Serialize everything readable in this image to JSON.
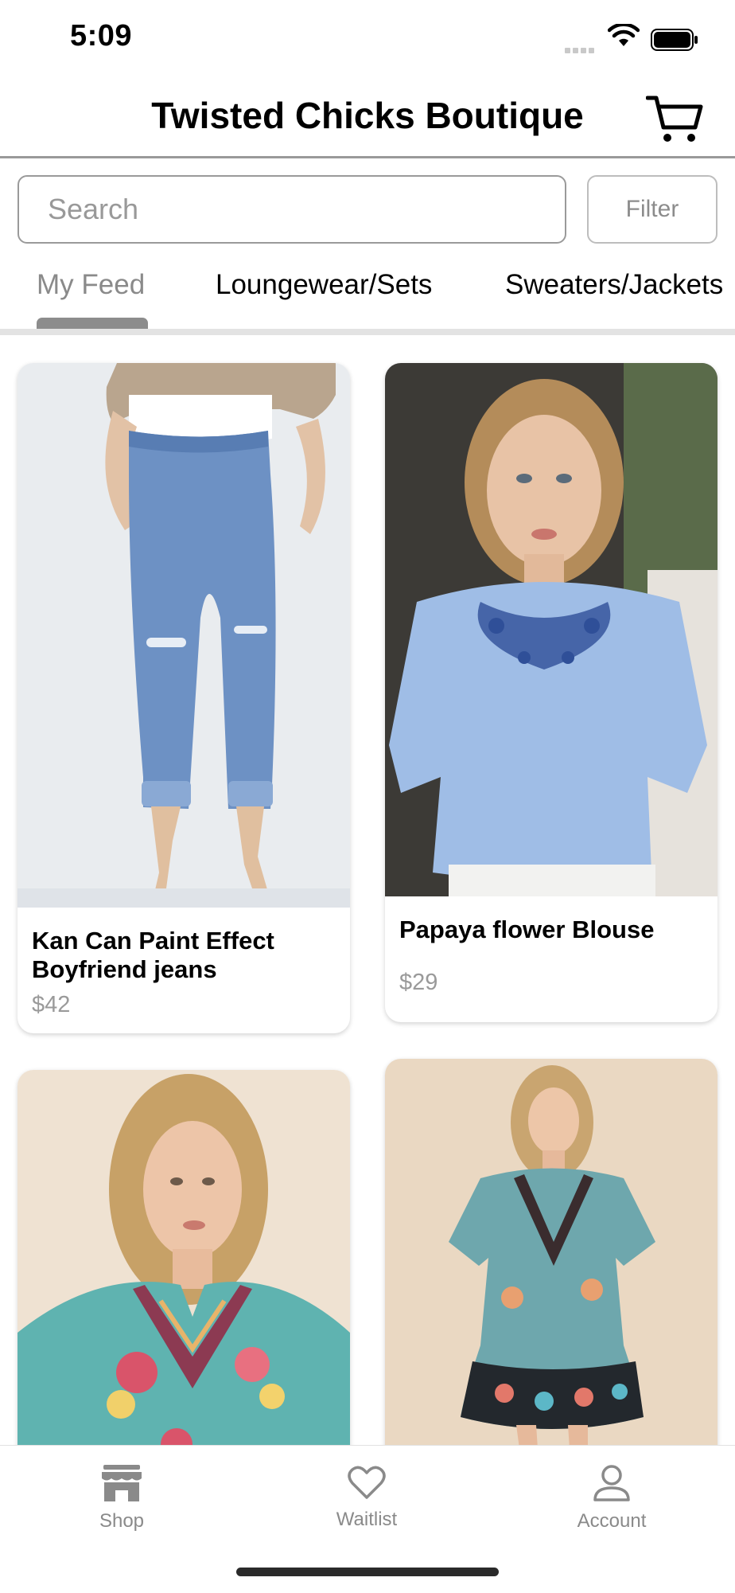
{
  "status": {
    "time": "5:09"
  },
  "header": {
    "title": "Twisted Chicks Boutique"
  },
  "search": {
    "placeholder": "Search",
    "filter_label": "Filter"
  },
  "tabs": [
    {
      "label": "My Feed",
      "active": true
    },
    {
      "label": "Loungewear/Sets",
      "active": false
    },
    {
      "label": "Sweaters/Jackets",
      "active": false
    }
  ],
  "products": [
    {
      "name": "Kan Can Paint Effect Boyfriend jeans",
      "price": "$42"
    },
    {
      "name": "Papaya flower Blouse",
      "price": "$29"
    }
  ],
  "bottom_nav": [
    {
      "label": "Shop",
      "icon": "store-icon"
    },
    {
      "label": "Waitlist",
      "icon": "heart-icon"
    },
    {
      "label": "Account",
      "icon": "person-icon"
    }
  ],
  "colors": {
    "accent_gray": "#8a8a8a",
    "divider": "#e3e3e3"
  }
}
